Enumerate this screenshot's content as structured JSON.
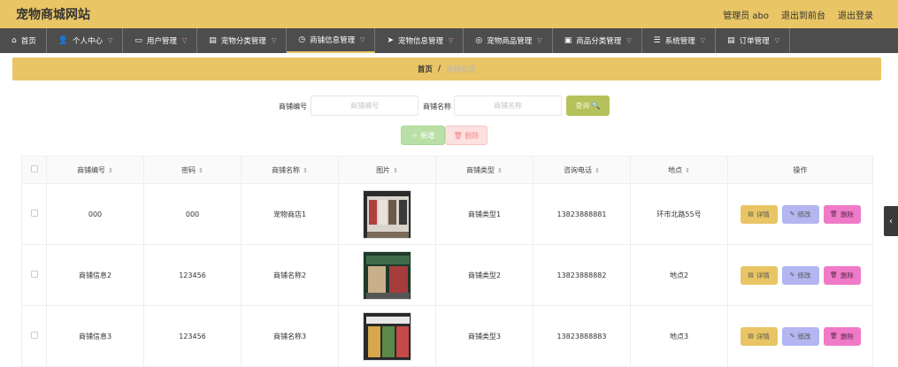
{
  "site": {
    "title": "宠物商城网站"
  },
  "user_menu": {
    "admin": "管理员 abo",
    "front": "退出到前台",
    "logout": "退出登录"
  },
  "nav": [
    {
      "label": "首页",
      "icon": "home-icon"
    },
    {
      "label": "个人中心",
      "icon": "user-icon"
    },
    {
      "label": "用户管理",
      "icon": "folder-icon"
    },
    {
      "label": "宠物分类管理",
      "icon": "doc-icon"
    },
    {
      "label": "商铺信息管理",
      "icon": "clock-icon"
    },
    {
      "label": "宠物信息管理",
      "icon": "send-icon"
    },
    {
      "label": "宠物商品管理",
      "icon": "globe-icon"
    },
    {
      "label": "商品分类管理",
      "icon": "box-icon"
    },
    {
      "label": "系统管理",
      "icon": "server-icon"
    },
    {
      "label": "订单管理",
      "icon": "doc-icon"
    }
  ],
  "breadcrumb": {
    "home": "首页",
    "sep": "/",
    "current": "商铺信息"
  },
  "search": {
    "shop_no_label": "商铺编号",
    "shop_no_placeholder": "商铺编号",
    "shop_name_label": "商铺名称",
    "shop_name_placeholder": "商铺名称",
    "button": "查询 🔍"
  },
  "actions": {
    "add": "＋ 新增",
    "delete": "🗑 删除"
  },
  "table": {
    "headers": [
      "商铺编号",
      "密码",
      "商铺名称",
      "图片",
      "商铺类型",
      "咨询电话",
      "地点",
      "操作"
    ],
    "rows": [
      {
        "no": "000",
        "password": "000",
        "name": "宠物商店1",
        "type": "商铺类型1",
        "phone": "13823888881",
        "place": "环市北路55号"
      },
      {
        "no": "商铺信息2",
        "password": "123456",
        "name": "商铺名称2",
        "type": "商铺类型2",
        "phone": "13823888882",
        "place": "地点2"
      },
      {
        "no": "商铺信息3",
        "password": "123456",
        "name": "商铺名称3",
        "type": "商铺类型3",
        "phone": "13823888883",
        "place": "地点3"
      }
    ],
    "op_detail": "详情",
    "op_edit": "修改",
    "op_delete": "删除"
  },
  "colors": {
    "brand": "#e9c565",
    "nav": "#4d4d4d",
    "search": "#b5c25b",
    "edit": "#b3b6f0",
    "delete": "#f07ac8"
  }
}
